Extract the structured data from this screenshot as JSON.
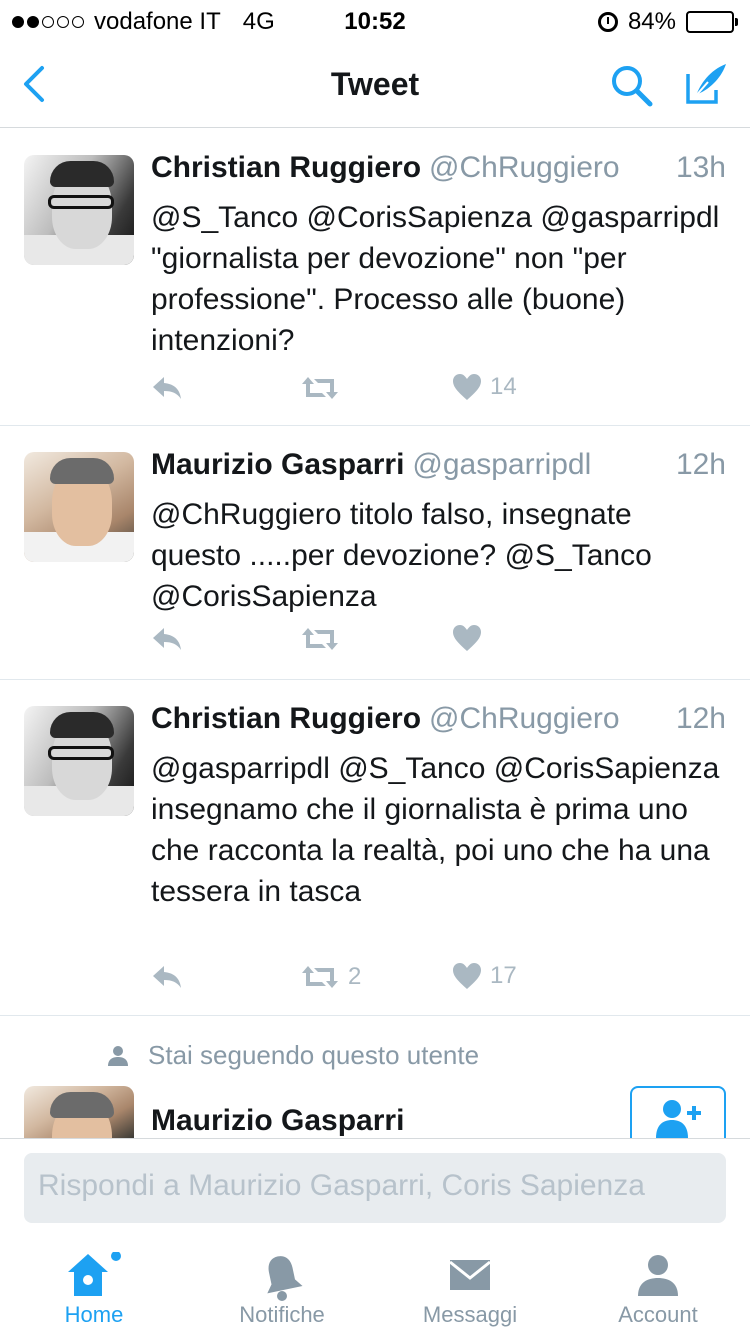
{
  "status_bar": {
    "carrier": "vodafone IT",
    "network": "4G",
    "time": "10:52",
    "battery": "84%",
    "battery_level": 0.84,
    "signal_dots_filled": 2,
    "signal_dots_total": 5
  },
  "navbar": {
    "title": "Tweet",
    "back_icon": "chevron-left-icon",
    "search_icon": "search-icon",
    "compose_icon": "compose-icon"
  },
  "colors": {
    "accent": "#1da1f2",
    "muted": "#8899a6",
    "action": "#aab8c2",
    "text": "#14171a"
  },
  "tweets": [
    {
      "name": "Christian Ruggiero",
      "handle": "@ChRuggiero",
      "age": "13h",
      "text": "@S_Tanco @CorisSapienza @gasparripdl \"giornalista per devozione\" non \"per professione\". Processo alle (buone) intenzioni?",
      "retweets": "",
      "likes": "14"
    },
    {
      "name": "Maurizio Gasparri",
      "handle": "@gasparripdl",
      "age": "12h",
      "text": "@ChRuggiero titolo falso, insegnate questo .....per devozione? @S_Tanco @CorisSapienza",
      "retweets": "",
      "likes": ""
    },
    {
      "name": "Christian Ruggiero",
      "handle": "@ChRuggiero",
      "age": "12h",
      "text": "@gasparripdl @S_Tanco @CorisSapienza insegnamo che il giornalista è prima uno che racconta la realtà, poi uno che ha una tessera in tasca",
      "retweets": "2",
      "likes": "17"
    }
  ],
  "follow": {
    "note": "Stai seguendo questo utente",
    "name": "Maurizio Gasparri",
    "button_icon": "add-user-icon"
  },
  "reply": {
    "placeholder": "Rispondi a Maurizio Gasparri, Coris Sapienza"
  },
  "tabbar": {
    "tabs": [
      {
        "label": "Home",
        "icon": "home-icon",
        "active": true,
        "badge": true
      },
      {
        "label": "Notifiche",
        "icon": "bell-icon",
        "active": false
      },
      {
        "label": "Messaggi",
        "icon": "envelope-icon",
        "active": false
      },
      {
        "label": "Account",
        "icon": "person-icon",
        "active": false
      }
    ]
  }
}
